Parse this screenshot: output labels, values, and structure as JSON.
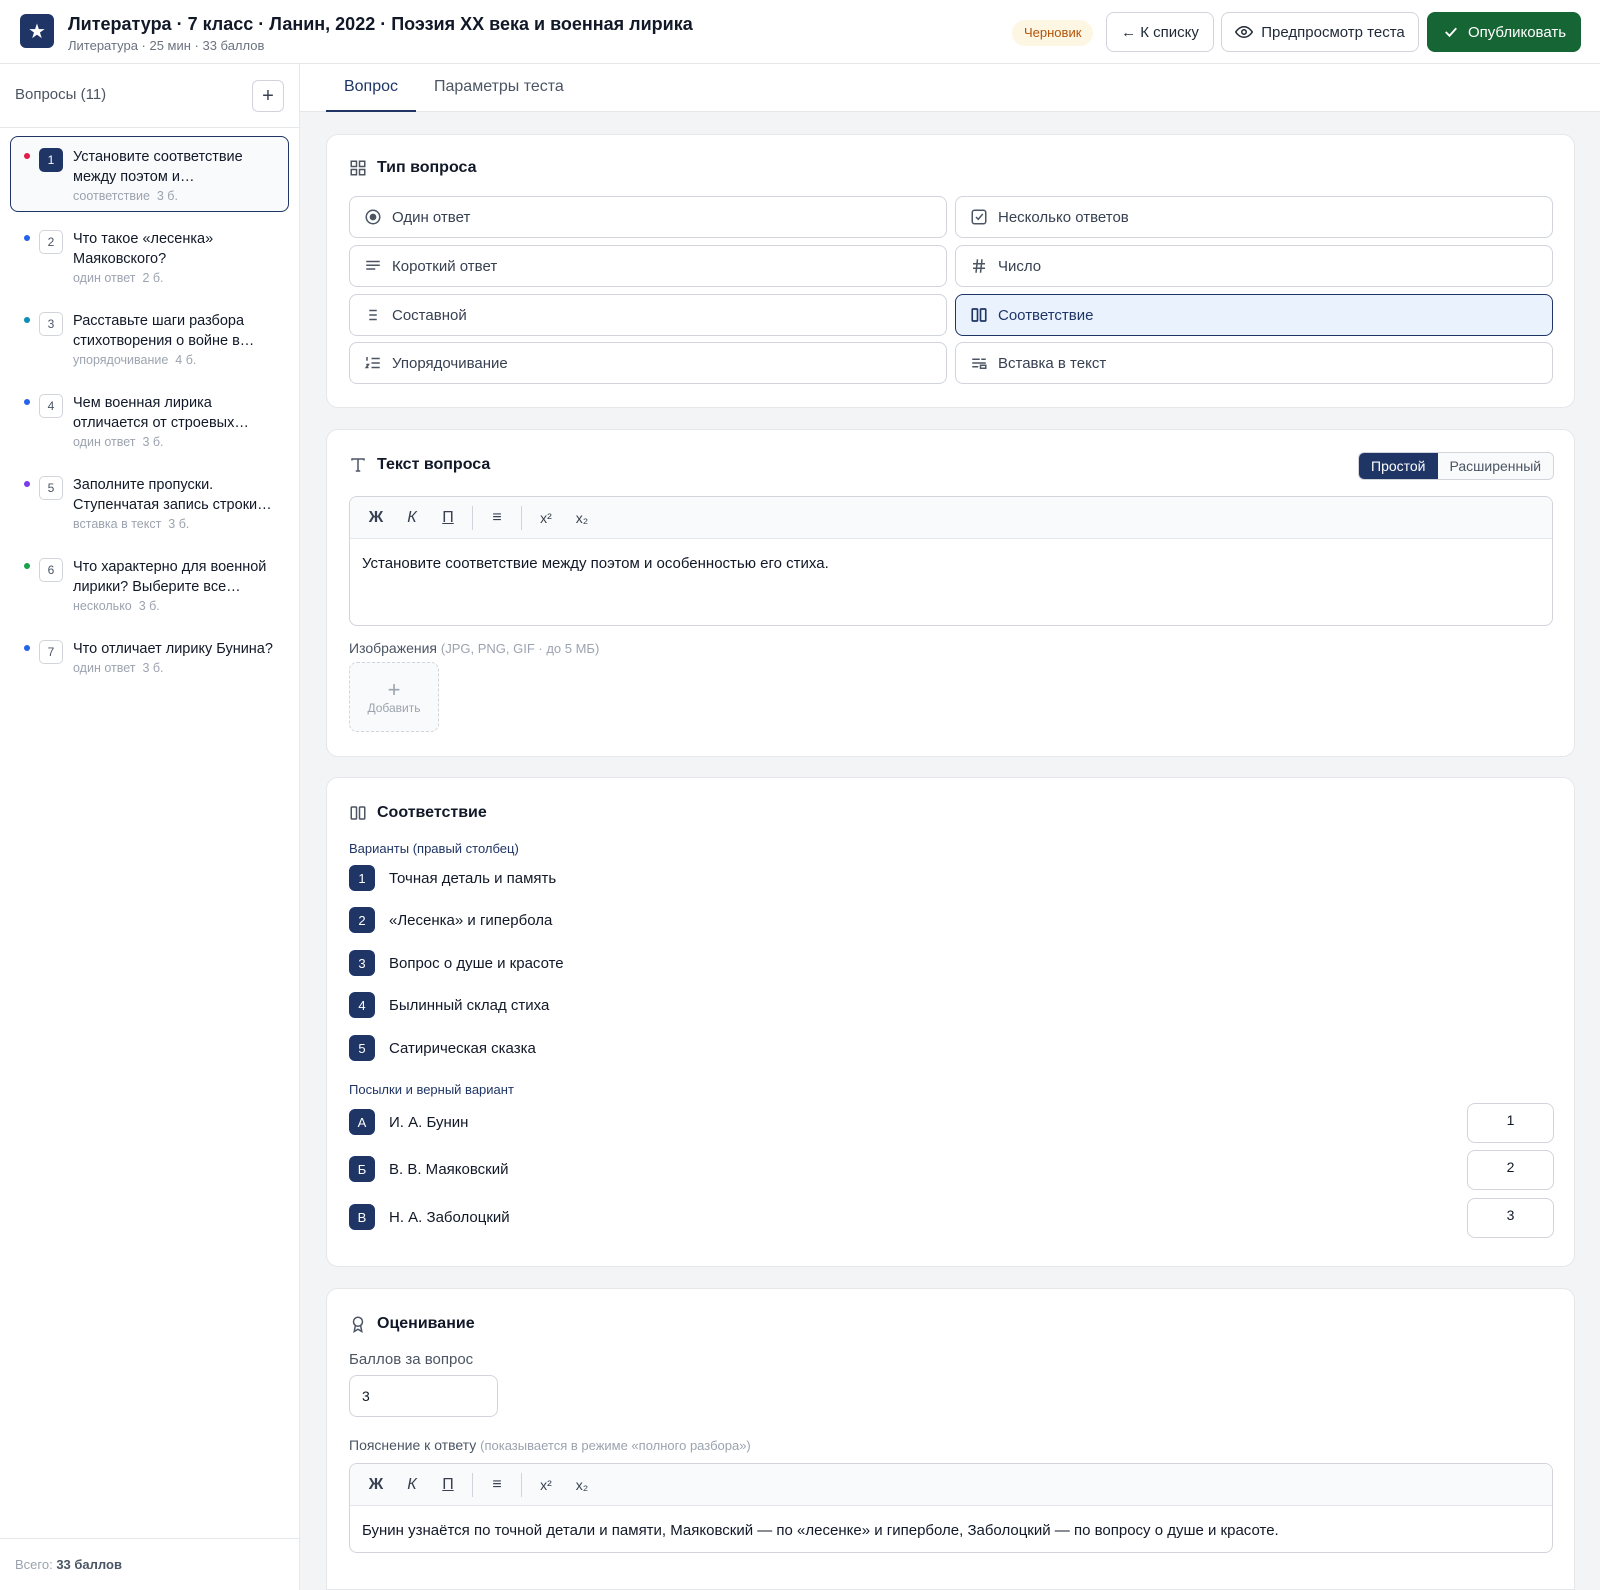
{
  "header": {
    "logo_icon": "star-icon",
    "title": "Литература · 7 класс · Ланин, 2022 · Поэзия XX века и военная лирика",
    "subtitle": "Литература · 25 мин · 33 баллов",
    "status_badge": "Черновик",
    "back_label": "← К списку",
    "preview_label": "Предпросмотр теста",
    "publish_label": "Опубликовать",
    "accent_color": "#1f3566",
    "publish_color": "#166534"
  },
  "sidebar": {
    "title": "Вопросы (11)",
    "add_label": "+",
    "items": [
      {
        "num": "1",
        "text": "Установите соответствие между поэтом и…",
        "type": "соответствие",
        "points": "3 б.",
        "dot": "#e11d48"
      },
      {
        "num": "2",
        "text": "Что такое «лесенка» Маяковского?",
        "type": "один ответ",
        "points": "2 б.",
        "dot": "#2563eb"
      },
      {
        "num": "3",
        "text": "Расставьте шаги разбора стихотворения о войне в…",
        "type": "упорядочивание",
        "points": "4 б.",
        "dot": "#0891b2"
      },
      {
        "num": "4",
        "text": "Чем военная лирика отличается от строевых…",
        "type": "один ответ",
        "points": "3 б.",
        "dot": "#2563eb"
      },
      {
        "num": "5",
        "text": "Заполните пропуски. Ступенчатая запись строки…",
        "type": "вставка в текст",
        "points": "3 б.",
        "dot": "#7c3aed"
      },
      {
        "num": "6",
        "text": "Что характерно для военной лирики? Выберите все…",
        "type": "несколько",
        "points": "3 б.",
        "dot": "#16a34a"
      },
      {
        "num": "7",
        "text": "Что отличает лирику Бунина?",
        "type": "один ответ",
        "points": "3 б.",
        "dot": "#2563eb"
      }
    ],
    "total_prefix": "Всего:",
    "total_value": "33 баллов"
  },
  "tabs": {
    "question": "Вопрос",
    "settings": "Параметры теста"
  },
  "question_type": {
    "title": "Тип вопроса",
    "options": [
      {
        "label": "Один ответ",
        "icon": "radio-icon"
      },
      {
        "label": "Несколько ответов",
        "icon": "checkbox-icon"
      },
      {
        "label": "Короткий ответ",
        "icon": "text-lines-icon"
      },
      {
        "label": "Число",
        "icon": "hash-icon"
      },
      {
        "label": "Составной",
        "icon": "list-icon"
      },
      {
        "label": "Соответствие",
        "icon": "columns-icon"
      },
      {
        "label": "Упорядочивание",
        "icon": "ordered-list-icon"
      },
      {
        "label": "Вставка в текст",
        "icon": "insert-text-icon"
      }
    ],
    "selected": "Соответствие"
  },
  "question_text": {
    "title": "Текст вопроса",
    "mode_simple": "Простой",
    "mode_advanced": "Расширенный",
    "toolbar": {
      "bold": "Ж",
      "italic": "К",
      "underline": "П",
      "list": "≡",
      "sup": "x²",
      "sub": "x₂"
    },
    "body": "Установите соответствие между поэтом и особенностью его стиха.",
    "images_label": "Изображения",
    "images_hint": "(JPG, PNG, GIF · до 5 МБ)",
    "add_image_plus": "+",
    "add_image_label": "Добавить"
  },
  "matching": {
    "title": "Соответствие",
    "options_label": "Варианты (правый столбец)",
    "options": [
      {
        "num": "1",
        "text": "Точная деталь и память"
      },
      {
        "num": "2",
        "text": "«Лесенка» и гипербола"
      },
      {
        "num": "3",
        "text": "Вопрос о душе и красоте"
      },
      {
        "num": "4",
        "text": "Былинный склад стиха"
      },
      {
        "num": "5",
        "text": "Сатирическая сказка"
      }
    ],
    "premises_label": "Посылки и верный вариант",
    "premises": [
      {
        "letter": "А",
        "text": "И. А. Бунин",
        "answer": "1"
      },
      {
        "letter": "Б",
        "text": "В. В. Маяковский",
        "answer": "2"
      },
      {
        "letter": "В",
        "text": "Н. А. Заболоцкий",
        "answer": "3"
      }
    ]
  },
  "grading": {
    "title": "Оценивание",
    "points_label": "Баллов за вопрос",
    "points_value": "3",
    "explanation_label": "Пояснение к ответу",
    "explanation_hint": "(показывается в режиме «полного разбора»)",
    "explanation_body": "Бунин узнаётся по точной детали и памяти, Маяковский — по «лесенке» и гиперболе, Заболоцкий — по вопросу о душе и красоте."
  }
}
